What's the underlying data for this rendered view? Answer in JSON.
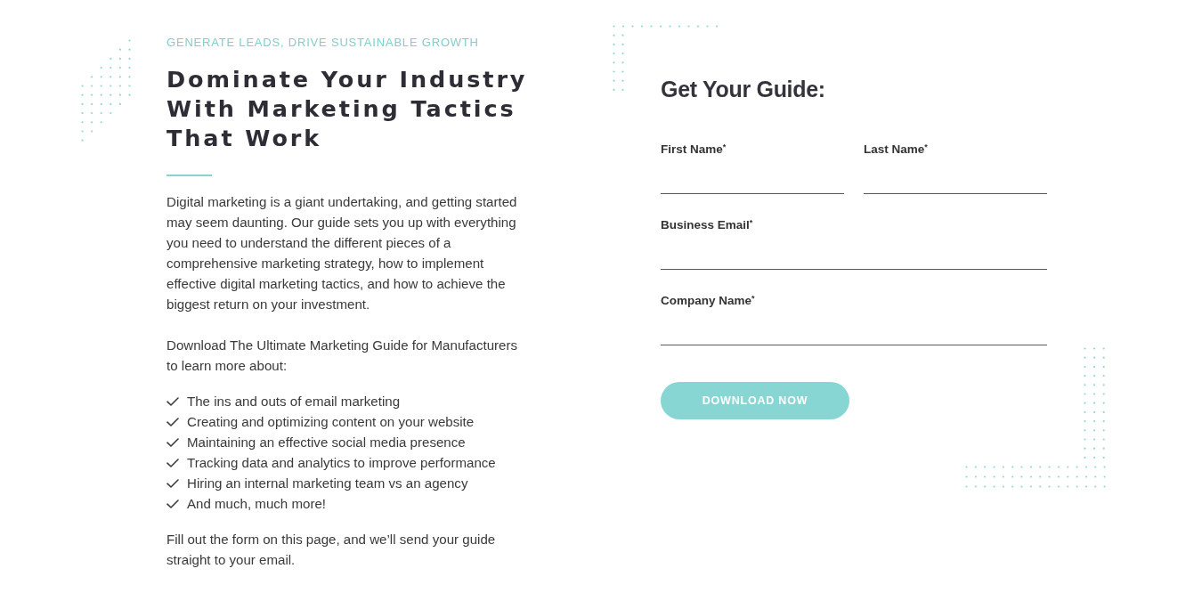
{
  "intro": {
    "eyebrow": "GENERATE LEADS, DRIVE SUSTAINABLE GROWTH",
    "heading": "Dominate Your Industry With Marketing Tactics That Work",
    "paragraphs": [
      "Digital marketing is a giant undertaking, and getting started may seem daunting. Our guide sets you up with everything you need to understand the different pieces of a comprehensive marketing strategy, how to implement effective digital marketing tactics, and how to achieve the biggest return on your investment.",
      "Download The Ultimate Marketing Guide for Manufacturers to learn more about:"
    ],
    "checklist": [
      "The ins and outs of email marketing",
      "Creating and optimizing content on your website",
      "Maintaining an effective social media presence",
      "Tracking data and analytics to improve performance",
      "Hiring an internal marketing team vs an agency",
      "And much, much more!"
    ],
    "closing": "Fill out the form on this page, and we’ll send your guide straight to your email."
  },
  "form": {
    "title": "Get Your Guide:",
    "rows": [
      [
        {
          "label": "First Name$^{*}$"
        },
        {
          "label": "Last Name$^{*}$"
        }
      ],
      [
        {
          "label": "Business Email$^{*}$"
        }
      ],
      [
        {
          "label": "Company Name$^{*}$"
        }
      ]
    ],
    "submit": "DOWNLOAD NOW"
  }
}
